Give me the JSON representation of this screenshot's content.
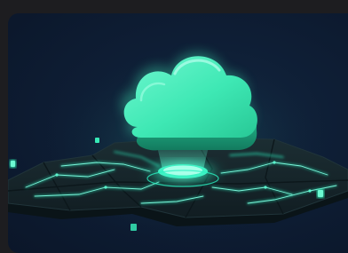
{
  "illustration": {
    "subject": "cloud-over-circuit-board",
    "icon": "cloud-icon",
    "colors": {
      "background": "#0e1e35",
      "frame": "#1d1d20",
      "cloud": "#3ee8b4",
      "cloud_shadow": "#1fa57f",
      "circuit_glow": "#2bf0c0",
      "board": "#16242a"
    }
  }
}
